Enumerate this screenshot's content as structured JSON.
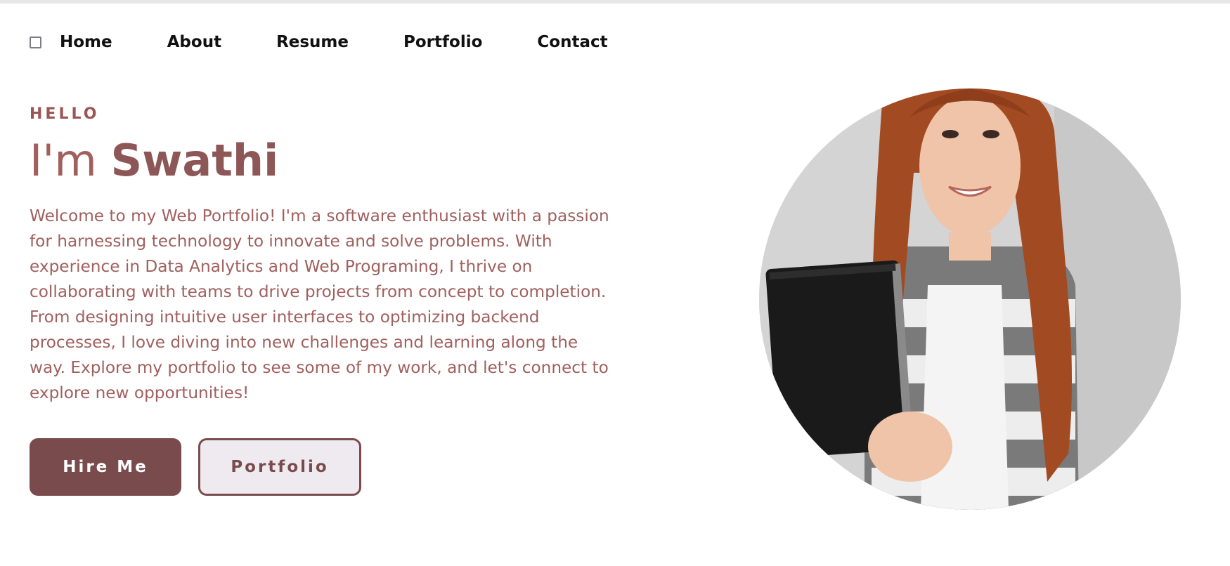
{
  "nav": {
    "menu_toggle_icon": "checkbox-square-icon",
    "items": [
      {
        "label": "Home"
      },
      {
        "label": "About"
      },
      {
        "label": "Resume"
      },
      {
        "label": "Portfolio"
      },
      {
        "label": "Contact"
      }
    ]
  },
  "hero": {
    "greeting": "HELLO",
    "headline_prefix": "I'm ",
    "name": "Swathi",
    "intro": "Welcome to my Web Portfolio! I'm a software enthusiast with a passion for harnessing technology to innovate and solve problems. With experience in Data Analytics and Web Programing, I thrive on collaborating with teams to drive projects from concept to completion. From designing intuitive user interfaces to optimizing backend processes, I love diving into new challenges and learning along the way. Explore my portfolio to see some of my work, and let's connect to explore new opportunities!",
    "buttons": {
      "hire": "Hire Me",
      "portfolio": "Portfolio"
    }
  },
  "colors": {
    "accent": "#7a4b4d",
    "text_accent": "#a0605e",
    "nav_text": "#111111",
    "background": "#ffffff"
  }
}
